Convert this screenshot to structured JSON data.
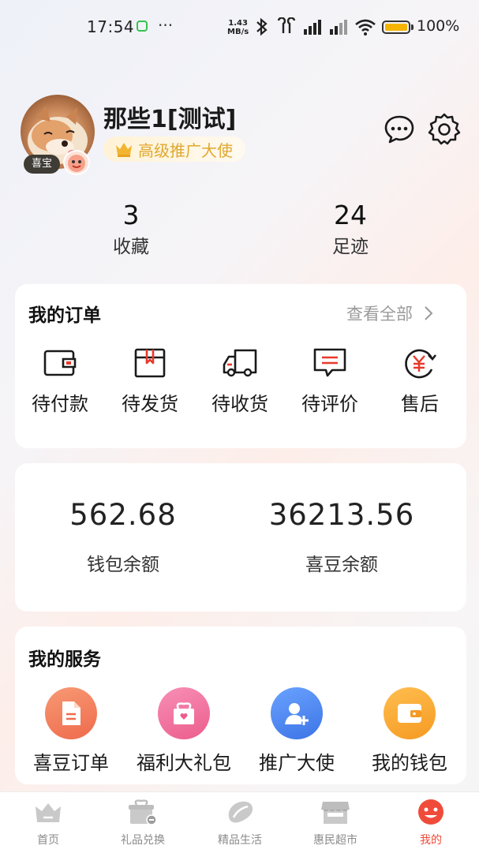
{
  "status_bar": {
    "time": "17:54",
    "net_speed_value": "1.43",
    "net_speed_unit": "MB/s",
    "battery": "100%"
  },
  "profile": {
    "name": "那些1[测试]",
    "level": "高级推广大使",
    "avatar_badge": "喜宝",
    "stats": [
      {
        "value": "3",
        "label": "收藏"
      },
      {
        "value": "24",
        "label": "足迹"
      }
    ]
  },
  "orders": {
    "title": "我的订单",
    "view_all": "查看全部",
    "items": [
      {
        "label": "待付款",
        "icon": "wallet-icon"
      },
      {
        "label": "待发货",
        "icon": "package-icon"
      },
      {
        "label": "待收货",
        "icon": "truck-icon"
      },
      {
        "label": "待评价",
        "icon": "comment-icon"
      },
      {
        "label": "售后",
        "icon": "yuan-refund-icon"
      }
    ]
  },
  "wallet": {
    "items": [
      {
        "value": "562.68",
        "label": "钱包余额"
      },
      {
        "value": "36213.56",
        "label": "喜豆余额"
      }
    ]
  },
  "services": {
    "title": "我的服务",
    "items": [
      {
        "label": "喜豆订单",
        "icon": "document-icon",
        "color": "#f47a55"
      },
      {
        "label": "福利大礼包",
        "icon": "gift-icon",
        "color": "#f06b9a"
      },
      {
        "label": "推广大使",
        "icon": "add-user-icon",
        "color": "#4c86f0"
      },
      {
        "label": "我的钱包",
        "icon": "wallet-icon",
        "color": "#f5a133"
      }
    ]
  },
  "tabbar": {
    "items": [
      {
        "label": "首页",
        "icon": "home-crown-icon"
      },
      {
        "label": "礼品兑换",
        "icon": "gift-exchange-icon"
      },
      {
        "label": "精品生活",
        "icon": "bean-icon"
      },
      {
        "label": "惠民超市",
        "icon": "store-icon"
      },
      {
        "label": "我的",
        "icon": "smile-face-icon",
        "active": true
      }
    ],
    "active_color": "#f04b3a"
  }
}
